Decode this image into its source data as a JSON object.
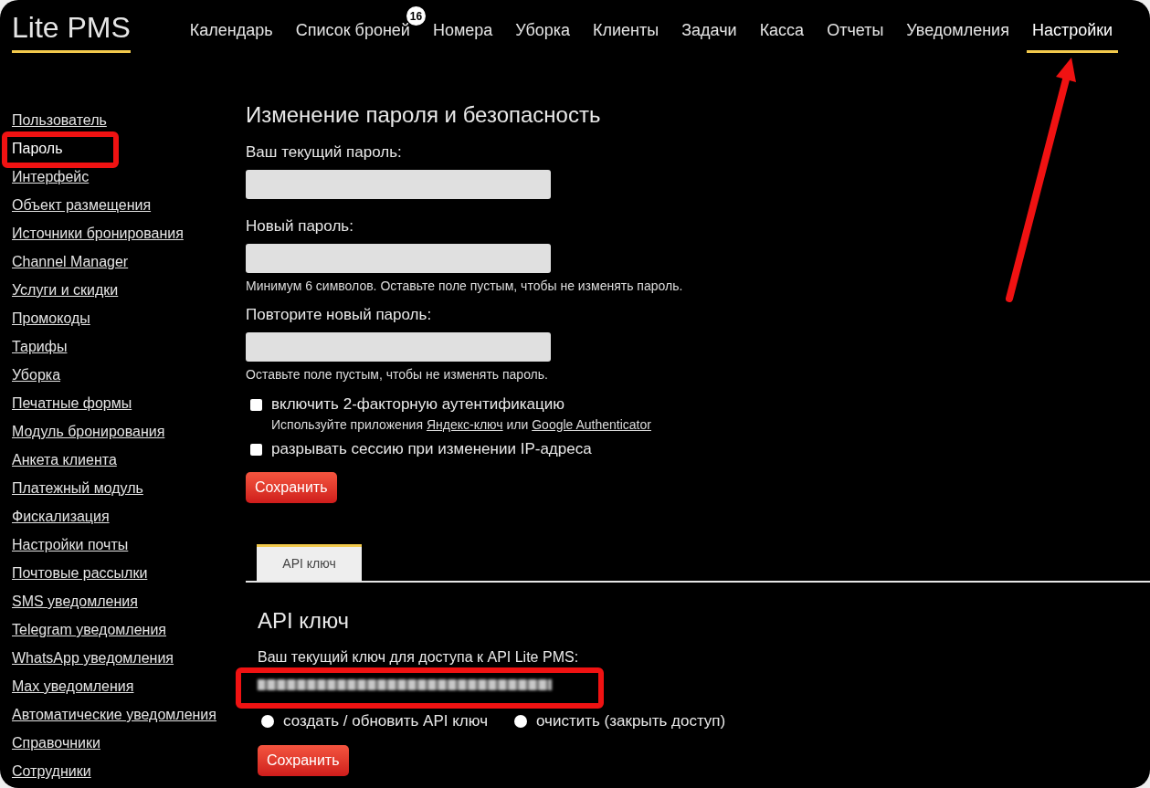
{
  "header": {
    "logo": "Lite PMS",
    "nav": [
      {
        "label": "Календарь",
        "selected": false,
        "arrow": false
      },
      {
        "label": "Список броней",
        "selected": false,
        "arrow": false,
        "badge": "16"
      },
      {
        "label": "Номера",
        "selected": false,
        "arrow": false
      },
      {
        "label": "Уборка",
        "selected": false,
        "arrow": false
      },
      {
        "label": "Клиенты",
        "selected": false,
        "arrow": false
      },
      {
        "label": "Задачи",
        "selected": false,
        "arrow": false
      },
      {
        "label": "Касса",
        "selected": false,
        "arrow": false
      },
      {
        "label": "Отчеты",
        "selected": false,
        "arrow": false
      },
      {
        "label": "Уведомления",
        "selected": false,
        "arrow": false
      },
      {
        "label": "Настройки",
        "selected": true,
        "arrow": true
      }
    ]
  },
  "sidebar": {
    "items": [
      {
        "label": "Пользователь",
        "selected": false,
        "highlighted": false
      },
      {
        "label": "Пароль",
        "selected": true,
        "highlighted": true
      },
      {
        "label": "Интерфейс",
        "selected": false,
        "highlighted": false
      },
      {
        "label": "Объект размещения",
        "selected": false,
        "highlighted": false
      },
      {
        "label": "Источники бронирования",
        "selected": false,
        "highlighted": false
      },
      {
        "label": "Channel Manager",
        "selected": false,
        "highlighted": false
      },
      {
        "label": "Услуги и скидки",
        "selected": false,
        "highlighted": false
      },
      {
        "label": "Промокоды",
        "selected": false,
        "highlighted": false
      },
      {
        "label": "Тарифы",
        "selected": false,
        "highlighted": false
      },
      {
        "label": "Уборка",
        "selected": false,
        "highlighted": false
      },
      {
        "label": "Печатные формы",
        "selected": false,
        "highlighted": false
      },
      {
        "label": "Модуль бронирования",
        "selected": false,
        "highlighted": false
      },
      {
        "label": "Анкета клиента",
        "selected": false,
        "highlighted": false
      },
      {
        "label": "Платежный модуль",
        "selected": false,
        "highlighted": false
      },
      {
        "label": "Фискализация",
        "selected": false,
        "highlighted": false
      },
      {
        "label": "Настройки почты",
        "selected": false,
        "highlighted": false
      },
      {
        "label": "Почтовые рассылки",
        "selected": false,
        "highlighted": false
      },
      {
        "label": "SMS уведомления",
        "selected": false,
        "highlighted": false
      },
      {
        "label": "Telegram уведомления",
        "selected": false,
        "highlighted": false
      },
      {
        "label": "WhatsApp уведомления",
        "selected": false,
        "highlighted": false
      },
      {
        "label": "Max уведомления",
        "selected": false,
        "highlighted": false
      },
      {
        "label": "Автоматические уведомления",
        "selected": false,
        "highlighted": false
      },
      {
        "label": "Справочники",
        "selected": false,
        "highlighted": false
      },
      {
        "label": "Сотрудники",
        "selected": false,
        "highlighted": false
      }
    ]
  },
  "password_form": {
    "title": "Изменение пароля и безопасность",
    "fields": [
      {
        "label": "Ваш текущий пароль:"
      },
      {
        "label": "Новый пароль:",
        "hint": "Минимум 6 символов. Оставьте поле пустым, чтобы не изменять пароль."
      },
      {
        "label": "Повторите новый пароль:",
        "hint": "Оставьте поле пустым, чтобы не изменять пароль."
      }
    ],
    "options": [
      {
        "label": "включить 2-факторную аутентификацию",
        "checked": false,
        "note": [
          {
            "kind": "text",
            "text": "Используйте приложения "
          },
          {
            "kind": "link",
            "text": "Яндекс-ключ"
          },
          {
            "kind": "text",
            "text": " или "
          },
          {
            "kind": "link",
            "text": "Google Authenticator"
          }
        ]
      },
      {
        "label": "разрывать сессию при изменении IP-адреса",
        "checked": false
      }
    ],
    "save_button": "Сохранить"
  },
  "tabs": [
    {
      "label": "API ключ",
      "selected": true
    }
  ],
  "api_key": {
    "title": "API ключ",
    "label": "Ваш текущий ключ для доступа к API Lite PMS:",
    "highlighted": true,
    "actions": [
      {
        "label": "создать / обновить API ключ",
        "selected": false
      },
      {
        "label": "очистить (закрыть доступ)",
        "selected": false
      }
    ],
    "save_button": "Сохранить"
  }
}
